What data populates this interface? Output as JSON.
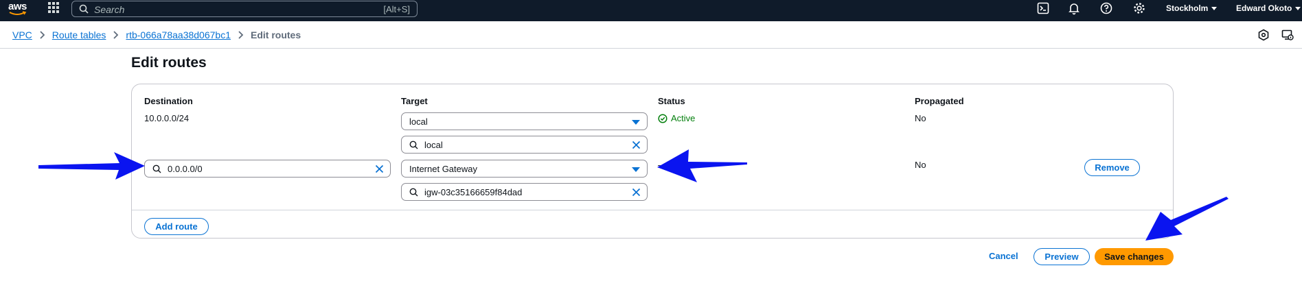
{
  "topnav": {
    "logo_text": "aws",
    "search_placeholder": "Search",
    "search_shortcut": "[Alt+S]",
    "region": "Stockholm",
    "user": "Edward Okoto",
    "icons": [
      "grid-icon",
      "cloudshell-icon",
      "bell-icon",
      "help-icon",
      "gear-icon"
    ]
  },
  "breadcrumb": {
    "items": [
      "VPC",
      "Route tables",
      "rtb-066a78aa38d067bc1"
    ],
    "current": "Edit routes"
  },
  "page": {
    "title": "Edit routes"
  },
  "table": {
    "headers": {
      "destination": "Destination",
      "target": "Target",
      "status": "Status",
      "propagated": "Propagated"
    },
    "rows": [
      {
        "destination": "10.0.0.0/24",
        "target_type": "local",
        "target_value": "local",
        "status": "Active",
        "propagated": "No"
      },
      {
        "destination": "0.0.0.0/0",
        "target_type": "Internet Gateway",
        "target_value": "igw-03c35166659f84dad",
        "status": "–",
        "propagated": "No",
        "remove_label": "Remove"
      }
    ],
    "add_route_label": "Add route"
  },
  "footer": {
    "cancel_label": "Cancel",
    "preview_label": "Preview",
    "save_label": "Save changes"
  },
  "colors": {
    "nav_bg": "#0f1b2a",
    "link": "#0972d3",
    "primary": "#ff9900",
    "success": "#037f0c",
    "annotation_arrow": "#0a14f0"
  }
}
